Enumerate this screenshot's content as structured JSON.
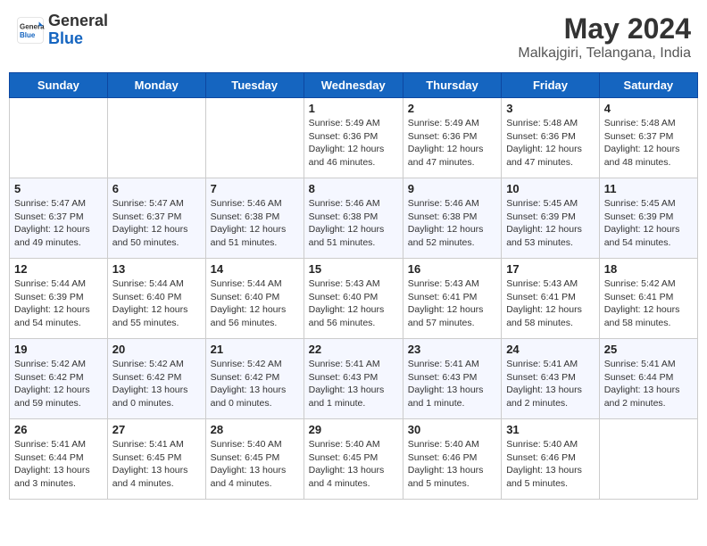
{
  "logo": {
    "line1": "General",
    "line2": "Blue"
  },
  "title": "May 2024",
  "subtitle": "Malkajgiri, Telangana, India",
  "headers": [
    "Sunday",
    "Monday",
    "Tuesday",
    "Wednesday",
    "Thursday",
    "Friday",
    "Saturday"
  ],
  "weeks": [
    [
      {
        "day": "",
        "info": ""
      },
      {
        "day": "",
        "info": ""
      },
      {
        "day": "",
        "info": ""
      },
      {
        "day": "1",
        "info": "Sunrise: 5:49 AM\nSunset: 6:36 PM\nDaylight: 12 hours\nand 46 minutes."
      },
      {
        "day": "2",
        "info": "Sunrise: 5:49 AM\nSunset: 6:36 PM\nDaylight: 12 hours\nand 47 minutes."
      },
      {
        "day": "3",
        "info": "Sunrise: 5:48 AM\nSunset: 6:36 PM\nDaylight: 12 hours\nand 47 minutes."
      },
      {
        "day": "4",
        "info": "Sunrise: 5:48 AM\nSunset: 6:37 PM\nDaylight: 12 hours\nand 48 minutes."
      }
    ],
    [
      {
        "day": "5",
        "info": "Sunrise: 5:47 AM\nSunset: 6:37 PM\nDaylight: 12 hours\nand 49 minutes."
      },
      {
        "day": "6",
        "info": "Sunrise: 5:47 AM\nSunset: 6:37 PM\nDaylight: 12 hours\nand 50 minutes."
      },
      {
        "day": "7",
        "info": "Sunrise: 5:46 AM\nSunset: 6:38 PM\nDaylight: 12 hours\nand 51 minutes."
      },
      {
        "day": "8",
        "info": "Sunrise: 5:46 AM\nSunset: 6:38 PM\nDaylight: 12 hours\nand 51 minutes."
      },
      {
        "day": "9",
        "info": "Sunrise: 5:46 AM\nSunset: 6:38 PM\nDaylight: 12 hours\nand 52 minutes."
      },
      {
        "day": "10",
        "info": "Sunrise: 5:45 AM\nSunset: 6:39 PM\nDaylight: 12 hours\nand 53 minutes."
      },
      {
        "day": "11",
        "info": "Sunrise: 5:45 AM\nSunset: 6:39 PM\nDaylight: 12 hours\nand 54 minutes."
      }
    ],
    [
      {
        "day": "12",
        "info": "Sunrise: 5:44 AM\nSunset: 6:39 PM\nDaylight: 12 hours\nand 54 minutes."
      },
      {
        "day": "13",
        "info": "Sunrise: 5:44 AM\nSunset: 6:40 PM\nDaylight: 12 hours\nand 55 minutes."
      },
      {
        "day": "14",
        "info": "Sunrise: 5:44 AM\nSunset: 6:40 PM\nDaylight: 12 hours\nand 56 minutes."
      },
      {
        "day": "15",
        "info": "Sunrise: 5:43 AM\nSunset: 6:40 PM\nDaylight: 12 hours\nand 56 minutes."
      },
      {
        "day": "16",
        "info": "Sunrise: 5:43 AM\nSunset: 6:41 PM\nDaylight: 12 hours\nand 57 minutes."
      },
      {
        "day": "17",
        "info": "Sunrise: 5:43 AM\nSunset: 6:41 PM\nDaylight: 12 hours\nand 58 minutes."
      },
      {
        "day": "18",
        "info": "Sunrise: 5:42 AM\nSunset: 6:41 PM\nDaylight: 12 hours\nand 58 minutes."
      }
    ],
    [
      {
        "day": "19",
        "info": "Sunrise: 5:42 AM\nSunset: 6:42 PM\nDaylight: 12 hours\nand 59 minutes."
      },
      {
        "day": "20",
        "info": "Sunrise: 5:42 AM\nSunset: 6:42 PM\nDaylight: 13 hours\nand 0 minutes."
      },
      {
        "day": "21",
        "info": "Sunrise: 5:42 AM\nSunset: 6:42 PM\nDaylight: 13 hours\nand 0 minutes."
      },
      {
        "day": "22",
        "info": "Sunrise: 5:41 AM\nSunset: 6:43 PM\nDaylight: 13 hours\nand 1 minute."
      },
      {
        "day": "23",
        "info": "Sunrise: 5:41 AM\nSunset: 6:43 PM\nDaylight: 13 hours\nand 1 minute."
      },
      {
        "day": "24",
        "info": "Sunrise: 5:41 AM\nSunset: 6:43 PM\nDaylight: 13 hours\nand 2 minutes."
      },
      {
        "day": "25",
        "info": "Sunrise: 5:41 AM\nSunset: 6:44 PM\nDaylight: 13 hours\nand 2 minutes."
      }
    ],
    [
      {
        "day": "26",
        "info": "Sunrise: 5:41 AM\nSunset: 6:44 PM\nDaylight: 13 hours\nand 3 minutes."
      },
      {
        "day": "27",
        "info": "Sunrise: 5:41 AM\nSunset: 6:45 PM\nDaylight: 13 hours\nand 4 minutes."
      },
      {
        "day": "28",
        "info": "Sunrise: 5:40 AM\nSunset: 6:45 PM\nDaylight: 13 hours\nand 4 minutes."
      },
      {
        "day": "29",
        "info": "Sunrise: 5:40 AM\nSunset: 6:45 PM\nDaylight: 13 hours\nand 4 minutes."
      },
      {
        "day": "30",
        "info": "Sunrise: 5:40 AM\nSunset: 6:46 PM\nDaylight: 13 hours\nand 5 minutes."
      },
      {
        "day": "31",
        "info": "Sunrise: 5:40 AM\nSunset: 6:46 PM\nDaylight: 13 hours\nand 5 minutes."
      },
      {
        "day": "",
        "info": ""
      }
    ]
  ]
}
